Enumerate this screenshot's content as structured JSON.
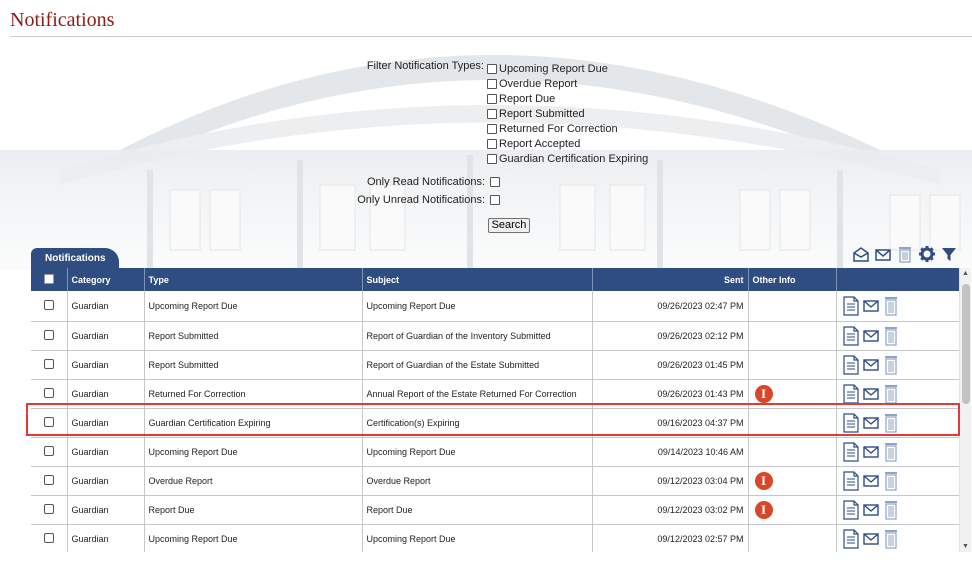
{
  "page": {
    "title": "Notifications"
  },
  "filters": {
    "types_label": "Filter Notification Types:",
    "types": [
      "Upcoming Report Due",
      "Overdue Report",
      "Report Due",
      "Report Submitted",
      "Returned For Correction",
      "Report Accepted",
      "Guardian Certification Expiring"
    ],
    "only_read_label": "Only Read Notifications:",
    "only_unread_label": "Only Unread Notifications:",
    "search_label": "Search"
  },
  "grid": {
    "tab_label": "Notifications",
    "toolbar_icons": [
      "mark-read-icon",
      "mail-icon",
      "trash-icon",
      "gear-icon",
      "filter-icon"
    ],
    "columns": {
      "category": "Category",
      "type": "Type",
      "subject": "Subject",
      "sent": "Sent",
      "other_info": "Other Info"
    },
    "rows": [
      {
        "category": "Guardian",
        "type": "Upcoming Report Due",
        "subject": "Upcoming Report Due",
        "sent": "09/26/2023 02:47 PM",
        "info": ""
      },
      {
        "category": "Guardian",
        "type": "Report Submitted",
        "subject": "Report of Guardian of the Inventory Submitted",
        "sent": "09/26/2023 02:12 PM",
        "info": ""
      },
      {
        "category": "Guardian",
        "type": "Report Submitted",
        "subject": "Report of Guardian of the Estate Submitted",
        "sent": "09/26/2023 01:45 PM",
        "info": ""
      },
      {
        "category": "Guardian",
        "type": "Returned For Correction",
        "subject": "Annual Report of the Estate Returned For Correction",
        "sent": "09/26/2023 01:43 PM",
        "info": "I"
      },
      {
        "category": "Guardian",
        "type": "Guardian Certification Expiring",
        "subject": "Certification(s) Expiring",
        "sent": "09/16/2023 04:37 PM",
        "info": ""
      },
      {
        "category": "Guardian",
        "type": "Upcoming Report Due",
        "subject": "Upcoming Report Due",
        "sent": "09/14/2023 10:46 AM",
        "info": ""
      },
      {
        "category": "Guardian",
        "type": "Overdue Report",
        "subject": "Overdue Report",
        "sent": "09/12/2023 03:04 PM",
        "info": "I"
      },
      {
        "category": "Guardian",
        "type": "Report Due",
        "subject": "Report Due",
        "sent": "09/12/2023 03:02 PM",
        "info": "I"
      },
      {
        "category": "Guardian",
        "type": "Upcoming Report Due",
        "subject": "Upcoming Report Due",
        "sent": "09/12/2023 02:57 PM",
        "info": ""
      }
    ],
    "row_action_icons": [
      "document-icon",
      "mail-icon",
      "trash-icon"
    ]
  },
  "colors": {
    "header_bg": "#2f4d80",
    "title": "#8b1a1a",
    "info_badge": "#d9472b",
    "highlight": "#e53935"
  }
}
